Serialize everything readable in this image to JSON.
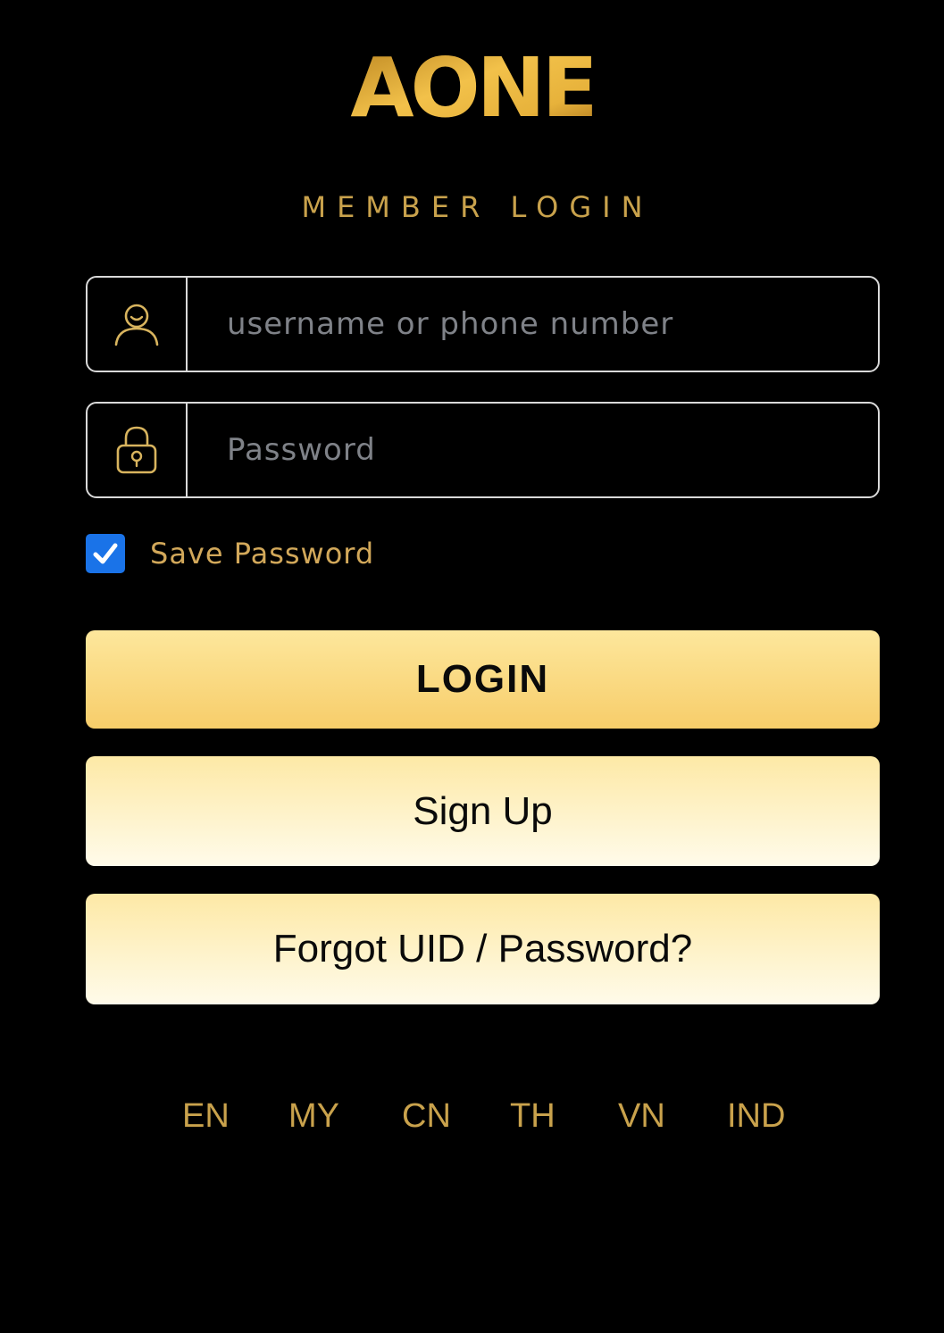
{
  "brand": {
    "logo_text": "AONE",
    "subtitle": "MEMBER LOGIN"
  },
  "form": {
    "username": {
      "placeholder": "username or phone number",
      "value": "",
      "icon": "user-icon"
    },
    "password": {
      "placeholder": "Password",
      "value": "",
      "icon": "lock-icon"
    },
    "save_password": {
      "label": "Save Password",
      "checked": true
    }
  },
  "buttons": {
    "login": "LOGIN",
    "signup": "Sign Up",
    "forgot": "Forgot UID / Password?"
  },
  "languages": [
    "EN",
    "MY",
    "CN",
    "TH",
    "VN",
    "IND"
  ],
  "colors": {
    "background": "#000000",
    "gold": "#c9a24c",
    "login_button": "#f9d77a",
    "secondary_button": "#fdf0bf",
    "checkbox": "#1a73e8",
    "field_border": "#d9d9d9"
  }
}
